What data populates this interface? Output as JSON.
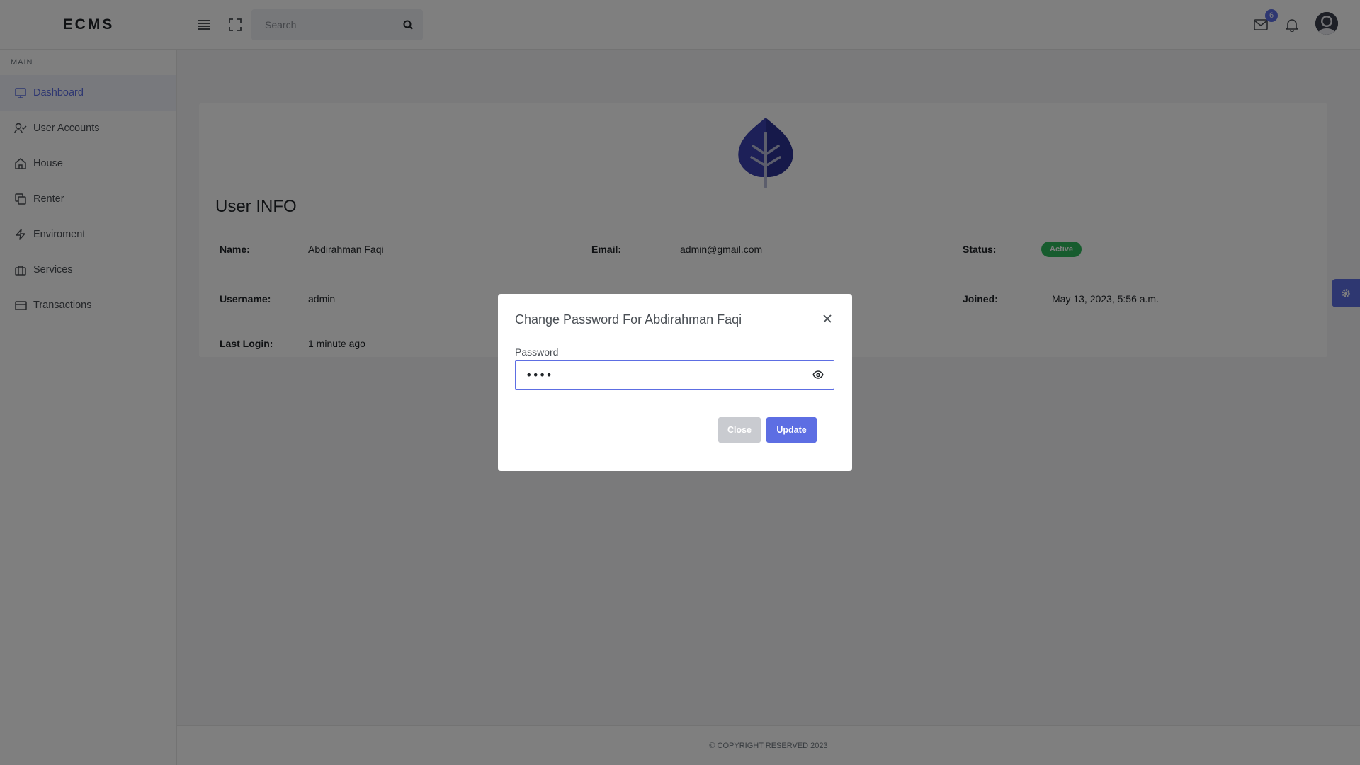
{
  "brand": "ECMS",
  "search": {
    "placeholder": "Search"
  },
  "header": {
    "mail_count": "6"
  },
  "sidebar": {
    "section": "MAIN",
    "items": [
      {
        "label": "Dashboard",
        "icon": "monitor-icon",
        "active": true
      },
      {
        "label": "User Accounts",
        "icon": "user-check-icon"
      },
      {
        "label": "House",
        "icon": "home-icon"
      },
      {
        "label": "Renter",
        "icon": "copy-icon"
      },
      {
        "label": "Enviroment",
        "icon": "lightning-icon"
      },
      {
        "label": "Services",
        "icon": "briefcase-icon"
      },
      {
        "label": "Transactions",
        "icon": "credit-card-icon"
      }
    ]
  },
  "user_info": {
    "title": "User INFO",
    "name_label": "Name:",
    "name": "Abdirahman Faqi",
    "email_label": "Email:",
    "email": "admin@gmail.com",
    "status_label": "Status:",
    "status": "Active",
    "username_label": "Username:",
    "username": "admin",
    "joined_label": "Joined:",
    "joined": "May 13, 2023, 5:56 a.m.",
    "last_login_label": "Last Login:",
    "last_login": "1 minute ago"
  },
  "footer": "© COPYRIGHT RESERVED 2023",
  "modal": {
    "title": "Change Password For Abdirahman Faqi",
    "password_label": "Password",
    "password_value": "••••",
    "close_label": "Close",
    "update_label": "Update"
  },
  "colors": {
    "accent": "#5d6ee3",
    "status_active": "#2eb85c"
  }
}
